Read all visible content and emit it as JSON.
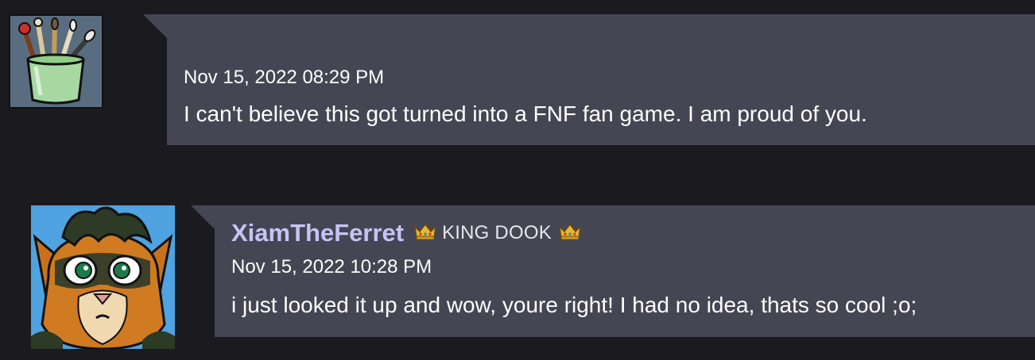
{
  "comments": [
    {
      "date": "Nov 15, 2022 08:29 PM",
      "text": "I can't believe this got turned into a FNF fan game. I am proud of you."
    },
    {
      "author": "XiamTheFerret",
      "rank": "KING DOOK",
      "date": "Nov 15, 2022 10:28 PM",
      "text": "i just looked it up and wow, youre right! I had no idea, thats so cool ;o;"
    }
  ],
  "colors": {
    "page_background": "#1b1b1f",
    "bubble_background": "#444653",
    "author_name": "#c8c3f4",
    "crown": "#e8b830"
  },
  "icons": [
    "paintbrush-cup-avatar",
    "ferret-avatar",
    "crown-icon"
  ]
}
